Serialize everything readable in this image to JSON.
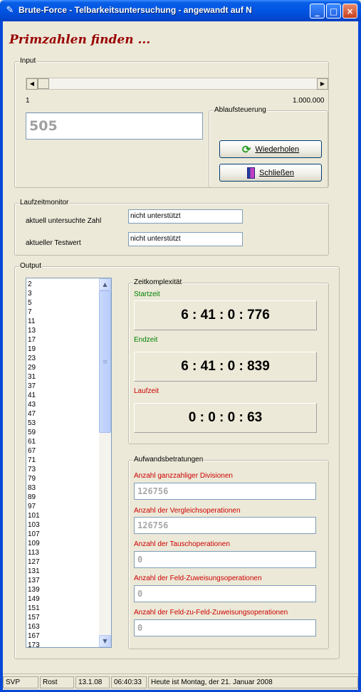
{
  "window": {
    "title": "Brute-Force - Telbarkeitsuntersuchung - angewandt auf N",
    "controls": {
      "minimize": "_",
      "maximize": "□",
      "close": "×"
    }
  },
  "heading": "Primzahlen finden ...",
  "input": {
    "group_label": "Input",
    "range_min": "1",
    "range_max": "1.000.000",
    "slider_position": 0.0005,
    "value": "505",
    "control": {
      "group_label": "Ablaufsteuerung",
      "repeat_button": "Wiederholen",
      "close_button": "Schließen"
    }
  },
  "runtime_monitor": {
    "group_label": "Laufzeitmonitor",
    "current_number_label": "aktuell untersuchte Zahl",
    "current_number_value": "nicht unterstützt",
    "current_test_label": "aktueller Testwert",
    "current_test_value": "nicht unterstützt"
  },
  "output": {
    "group_label": "Output",
    "primes": [
      "2",
      "3",
      "5",
      "7",
      "11",
      "13",
      "17",
      "19",
      "23",
      "29",
      "31",
      "37",
      "41",
      "43",
      "47",
      "53",
      "59",
      "61",
      "67",
      "71",
      "73",
      "79",
      "83",
      "89",
      "97",
      "101",
      "103",
      "107",
      "109",
      "113",
      "127",
      "131",
      "137",
      "139",
      "149",
      "151",
      "157",
      "163",
      "167",
      "173"
    ],
    "complexity": {
      "group_label": "Zeitkomplexität",
      "start_label": "Startzeit",
      "start_value": "6 : 41 : 0 : 776",
      "end_label": "Endzeit",
      "end_value": "6 : 41 : 0 : 839",
      "duration_label": "Laufzeit",
      "duration_value": "0 : 0 : 0 : 63"
    },
    "effort": {
      "group_label": "Aufwandsbetratungen",
      "divisions_label": "Anzahl ganzzahliger Divisionen",
      "divisions_value": "126756",
      "comparisons_label": "Anzahl der Vergleichsoperationen",
      "comparisons_value": "126756",
      "swaps_label": "Anzahl der Tauschoperationen",
      "swaps_value": "0",
      "field_assign_label": "Anzahl der Feld-Zuweisungsoperationen",
      "field_assign_value": "0",
      "field_to_field_label": "Anzahl der Feld-zu-Feld-Zuweisungsoperationen",
      "field_to_field_value": "0"
    }
  },
  "statusbar": {
    "panel1": "SVP",
    "panel2": "Rost",
    "panel3": "13.1.08",
    "panel4": "06:40:33",
    "panel5": "Heute ist Montag, der 21. Januar 2008"
  },
  "colors": {
    "heading": "#990000",
    "red_label": "#cc0000",
    "green_label": "#008000",
    "titlebar": "#0054e3"
  }
}
